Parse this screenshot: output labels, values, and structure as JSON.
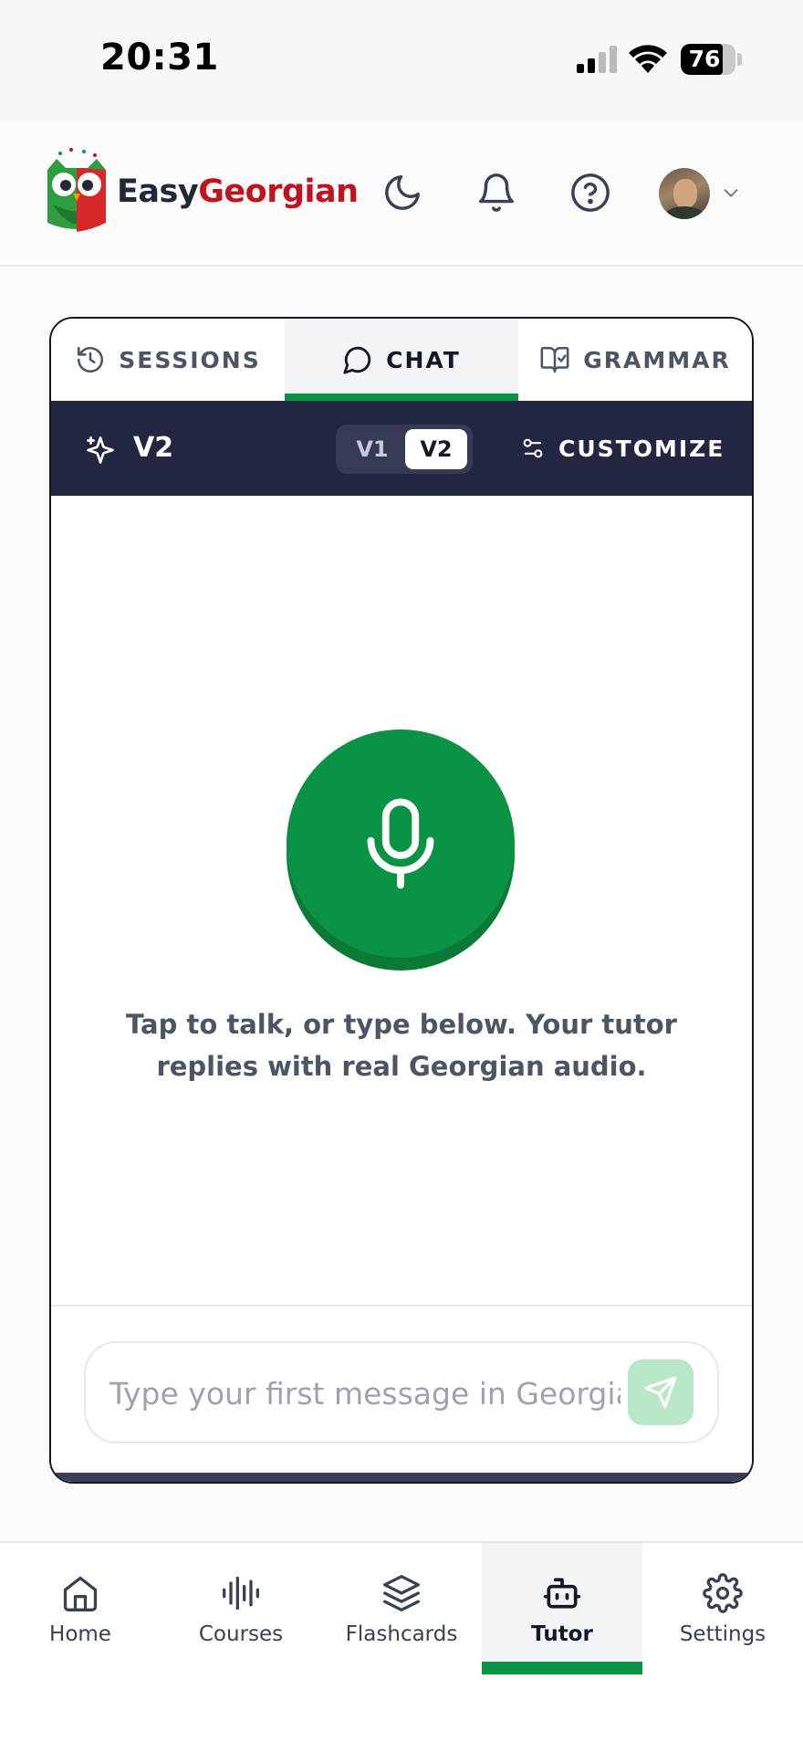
{
  "status_bar": {
    "time": "20:31",
    "battery_percent": "76",
    "battery_level": 0.76
  },
  "header": {
    "brand_part1": "Easy",
    "brand_part2": "Georgian",
    "icons": [
      "moon-icon",
      "bell-icon",
      "help-circle-icon",
      "avatar",
      "chevron-down-icon"
    ]
  },
  "tabs": [
    {
      "label": "SESSIONS",
      "icon": "history-icon",
      "active": false
    },
    {
      "label": "CHAT",
      "icon": "chat-bubble-icon",
      "active": true
    },
    {
      "label": "GRAMMAR",
      "icon": "book-check-icon",
      "active": false
    }
  ],
  "toolbar": {
    "version_label": "V2",
    "toggle_v1": "V1",
    "toggle_v2": "V2",
    "selected_version": "V2",
    "customize_label": "CUSTOMIZE"
  },
  "chat": {
    "hint": "Tap to talk, or type below. Your tutor replies with real Georgian audio.",
    "input_placeholder": "Type your first message in Georgian",
    "input_value": ""
  },
  "bottom_nav": [
    {
      "label": "Home",
      "icon": "home-icon",
      "active": false
    },
    {
      "label": "Courses",
      "icon": "audio-wave-icon",
      "active": false
    },
    {
      "label": "Flashcards",
      "icon": "layers-icon",
      "active": false
    },
    {
      "label": "Tutor",
      "icon": "bot-icon",
      "active": true
    },
    {
      "label": "Settings",
      "icon": "gear-icon",
      "active": false
    }
  ],
  "colors": {
    "accent_green": "#0a9344",
    "brand_red": "#c1121f",
    "toolbar_navy": "#232640"
  }
}
